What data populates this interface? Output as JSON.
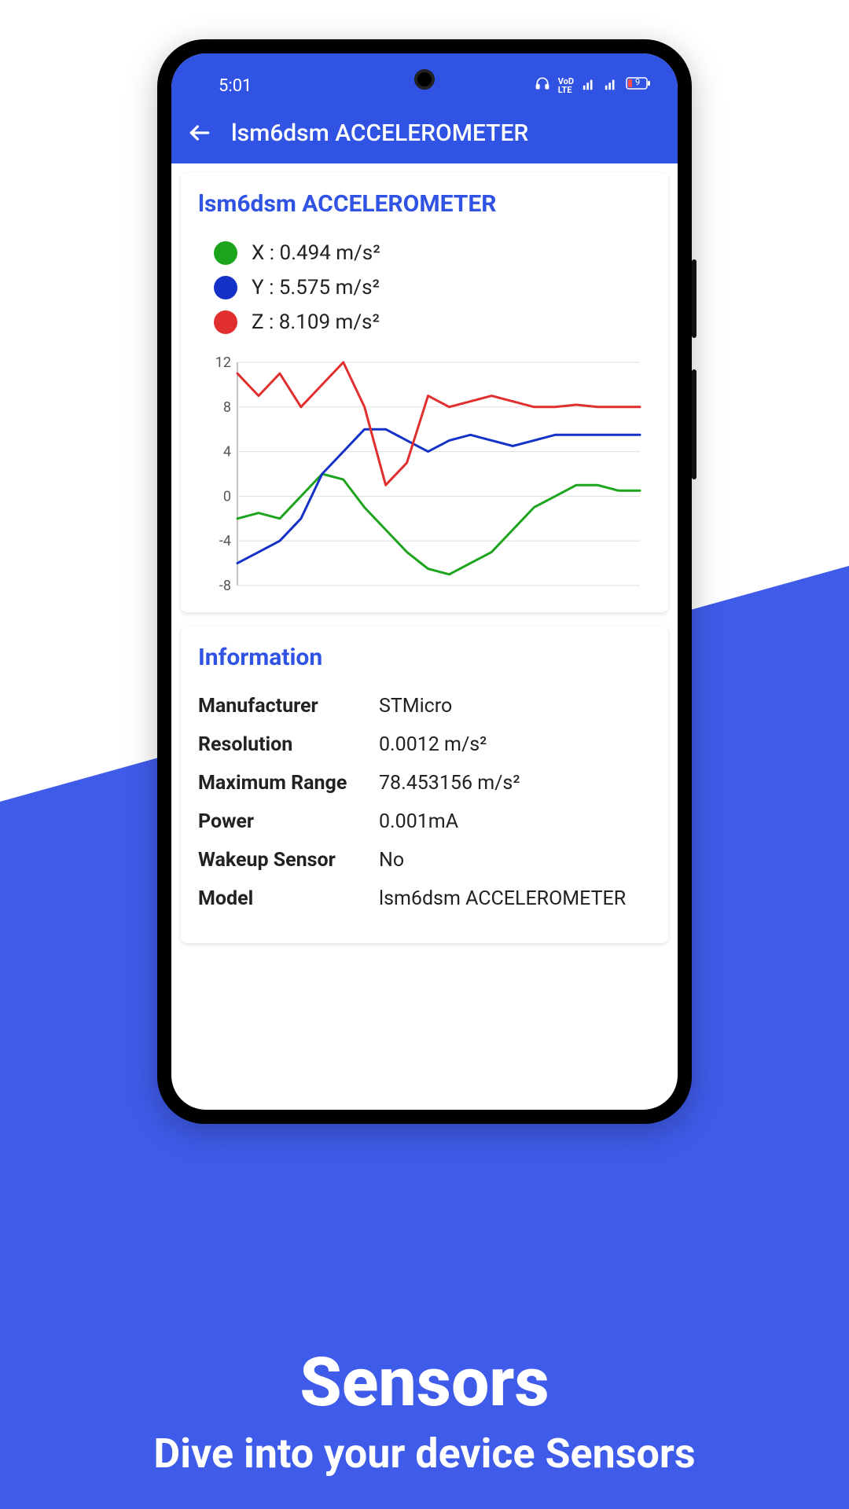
{
  "statusbar": {
    "time": "5:01",
    "battery": "9"
  },
  "appbar": {
    "title": "lsm6dsm ACCELEROMETER"
  },
  "sensor_card": {
    "title": "lsm6dsm ACCELEROMETER",
    "legend": [
      {
        "color": "#1da41d",
        "label": "X : 0.494 m/s²"
      },
      {
        "color": "#1432c7",
        "label": "Y : 5.575 m/s²"
      },
      {
        "color": "#e12f2f",
        "label": "Z : 8.109 m/s²"
      }
    ]
  },
  "chart_data": {
    "type": "line",
    "ylim": [
      -8,
      12
    ],
    "yticks": [
      -8,
      -4,
      0,
      4,
      8,
      12
    ],
    "x": [
      0,
      1,
      2,
      3,
      4,
      5,
      6,
      7,
      8,
      9,
      10,
      11,
      12,
      13,
      14,
      15,
      16,
      17,
      18,
      19
    ],
    "series": [
      {
        "name": "X",
        "color": "#1da41d",
        "values": [
          -2,
          -1.5,
          -2,
          0,
          2,
          1.5,
          -1,
          -3,
          -5,
          -6.5,
          -7,
          -6,
          -5,
          -3,
          -1,
          0,
          1,
          1,
          0.5,
          0.5
        ]
      },
      {
        "name": "Y",
        "color": "#1432c7",
        "values": [
          -6,
          -5,
          -4,
          -2,
          2,
          4,
          6,
          6,
          5,
          4,
          5,
          5.5,
          5,
          4.5,
          5,
          5.5,
          5.5,
          5.5,
          5.5,
          5.5
        ]
      },
      {
        "name": "Z",
        "color": "#e12f2f",
        "values": [
          11,
          9,
          11,
          8,
          10,
          12,
          8,
          1,
          3,
          9,
          8,
          8.5,
          9,
          8.5,
          8,
          8,
          8.2,
          8,
          8,
          8
        ]
      }
    ]
  },
  "info_card": {
    "title": "Information",
    "rows": [
      {
        "label": "Manufacturer",
        "value": "STMicro"
      },
      {
        "label": "Resolution",
        "value": "0.0012 m/s²"
      },
      {
        "label": "Maximum Range",
        "value": "78.453156 m/s²"
      },
      {
        "label": "Power",
        "value": "0.001mA"
      },
      {
        "label": "Wakeup Sensor",
        "value": "No"
      },
      {
        "label": "Model",
        "value": "lsm6dsm ACCELEROMETER"
      }
    ]
  },
  "promo": {
    "title": "Sensors",
    "subtitle": "Dive into your device Sensors"
  }
}
